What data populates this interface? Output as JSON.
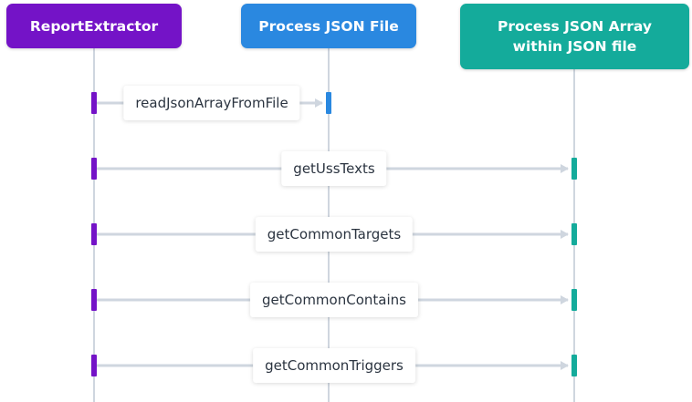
{
  "participants": [
    {
      "name": "ReportExtractor",
      "color": "#7413c7"
    },
    {
      "name": "Process JSON File",
      "color": "#2a88e0"
    },
    {
      "name": "Process JSON Array\nwithin JSON file",
      "color": "#14ab9b"
    }
  ],
  "messages": [
    {
      "label": "readJsonArrayFromFile",
      "from": 0,
      "to": 1
    },
    {
      "label": "getUssTexts",
      "from": 0,
      "to": 2
    },
    {
      "label": "getCommonTargets",
      "from": 0,
      "to": 2
    },
    {
      "label": "getCommonContains",
      "from": 0,
      "to": 2
    },
    {
      "label": "getCommonTriggers",
      "from": 0,
      "to": 2
    }
  ],
  "colors": {
    "lifeline": "#cfd6df",
    "arrow": "#cfd6df"
  }
}
